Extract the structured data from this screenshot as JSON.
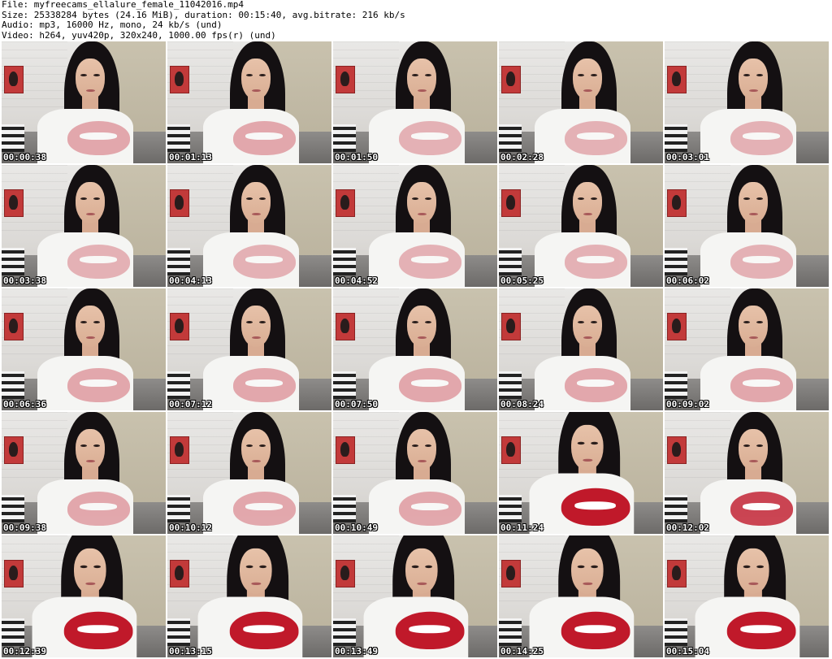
{
  "header": {
    "file_line": "File: myfreecams_ellalure_female_11042016.mp4",
    "size_line": "Size: 25338284 bytes (24.16 MiB), duration: 00:15:40, avg.bitrate: 216 kb/s",
    "audio_line": "Audio: mp3, 16000 Hz, mono, 24 kb/s (und)",
    "video_line": "Video: h264, yuv420p, 320x240, 1000.00 fps(r) (und)"
  },
  "thumbnails": [
    {
      "time": "00:00:38",
      "scale": 1.0,
      "print": 0.35
    },
    {
      "time": "00:01:13",
      "scale": 1.0,
      "print": 0.35
    },
    {
      "time": "00:01:50",
      "scale": 1.0,
      "print": 0.3
    },
    {
      "time": "00:02:28",
      "scale": 1.0,
      "print": 0.3
    },
    {
      "time": "00:03:01",
      "scale": 1.0,
      "print": 0.3
    },
    {
      "time": "00:03:38",
      "scale": 1.0,
      "print": 0.3
    },
    {
      "time": "00:04:13",
      "scale": 1.0,
      "print": 0.3
    },
    {
      "time": "00:04:52",
      "scale": 1.0,
      "print": 0.3
    },
    {
      "time": "00:05:25",
      "scale": 1.0,
      "print": 0.3
    },
    {
      "time": "00:06:02",
      "scale": 1.0,
      "print": 0.3
    },
    {
      "time": "00:06:36",
      "scale": 1.0,
      "print": 0.35
    },
    {
      "time": "00:07:12",
      "scale": 1.0,
      "print": 0.35
    },
    {
      "time": "00:07:50",
      "scale": 1.0,
      "print": 0.35
    },
    {
      "time": "00:08:24",
      "scale": 1.0,
      "print": 0.35
    },
    {
      "time": "00:09:02",
      "scale": 1.0,
      "print": 0.35
    },
    {
      "time": "00:09:38",
      "scale": 1.0,
      "print": 0.35
    },
    {
      "time": "00:10:12",
      "scale": 1.0,
      "print": 0.35
    },
    {
      "time": "00:10:49",
      "scale": 1.0,
      "print": 0.35
    },
    {
      "time": "00:11:24",
      "scale": 1.1,
      "print": 1.0
    },
    {
      "time": "00:12:02",
      "scale": 1.0,
      "print": 0.8
    },
    {
      "time": "00:12:39",
      "scale": 1.1,
      "print": 1.0
    },
    {
      "time": "00:13:15",
      "scale": 1.1,
      "print": 1.0
    },
    {
      "time": "00:13:49",
      "scale": 1.1,
      "print": 1.0
    },
    {
      "time": "00:14:25",
      "scale": 1.1,
      "print": 1.0
    },
    {
      "time": "00:15:04",
      "scale": 1.1,
      "print": 1.0
    }
  ]
}
